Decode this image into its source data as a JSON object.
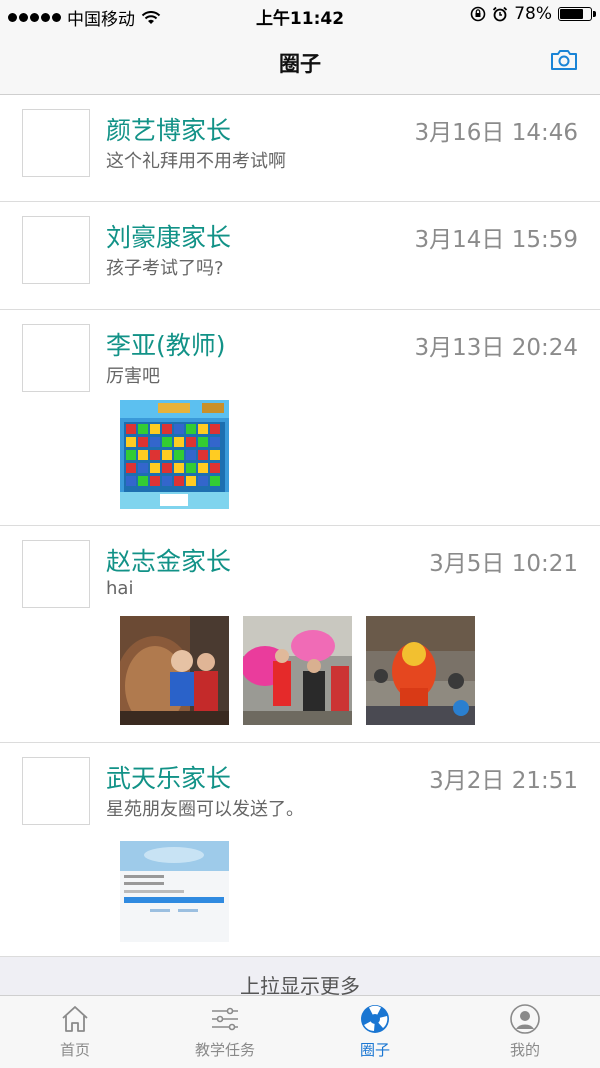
{
  "status_bar": {
    "carrier": "中国移动",
    "time": "上午11:42",
    "battery": "78%",
    "battery_level": 0.78
  },
  "nav": {
    "title": "圈子"
  },
  "posts": [
    {
      "author": "颜艺博家长",
      "time": "3月16日 14:46",
      "content": "这个礼拜用不用考试啊",
      "photo_count": 0
    },
    {
      "author": "刘豪康家长",
      "time": "3月14日 15:59",
      "content": "孩子考试了吗?",
      "photo_count": 0
    },
    {
      "author": "李亚(教师)",
      "time": "3月13日 20:24",
      "content": "厉害吧",
      "photo_count": 1
    },
    {
      "author": "赵志金家长",
      "time": "3月5日 10:21",
      "content": "hai",
      "photo_count": 3
    },
    {
      "author": "武天乐家长",
      "time": "3月2日 21:51",
      "content": "星苑朋友圈可以发送了。",
      "photo_count": 1
    }
  ],
  "load_more": "上拉显示更多",
  "tabs": [
    {
      "label": "首页",
      "icon": "home-icon",
      "active": false
    },
    {
      "label": "教学任务",
      "icon": "sliders-icon",
      "active": false
    },
    {
      "label": "圈子",
      "icon": "aperture-icon",
      "active": true
    },
    {
      "label": "我的",
      "icon": "user-icon",
      "active": false
    }
  ],
  "colors": {
    "accent": "#129287",
    "tab_active": "#1a76d2"
  }
}
